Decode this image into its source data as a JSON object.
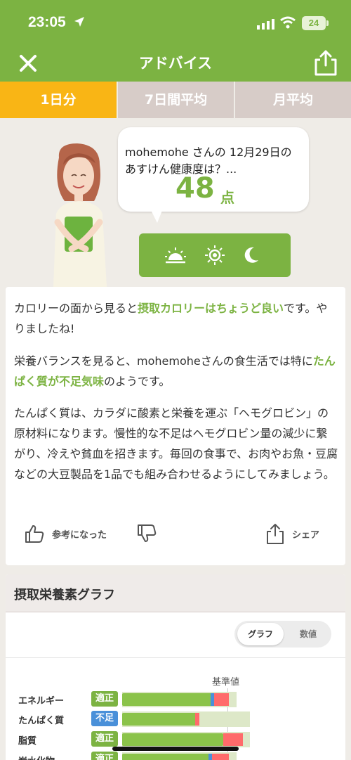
{
  "status": {
    "time": "23:05",
    "battery": "24"
  },
  "nav": {
    "title": "アドバイス"
  },
  "tabs": [
    {
      "label": "1日分",
      "active": true
    },
    {
      "label": "7日間平均",
      "active": false
    },
    {
      "label": "月平均",
      "active": false
    }
  ],
  "hero": {
    "question_line1": "mohemohe さんの 12月29日の",
    "question_line2": "あすけん健康度は？...",
    "score": "48",
    "score_unit": "点",
    "time_icons": [
      "sunrise-icon",
      "sun-icon",
      "moon-icon"
    ]
  },
  "advice": {
    "p1_a": "カロリーの面から見ると",
    "p1_hl": "摂取カロリーはちょうど良い",
    "p1_b": "です。やりましたね!",
    "p2_a": "栄養バランスを見ると、mohemoheさんの食生活では特に",
    "p2_hl": "たんぱく質が不足気味",
    "p2_b": "のようです。",
    "p3": "たんぱく質は、カラダに酸素と栄養を運ぶ「ヘモグロビン」の原材料になります。慢性的な不足はヘモグロビン量の減少に繋がり、冷えや貧血を招きます。毎回の食事で、お肉やお魚・豆腐などの大豆製品を1品でも組み合わせるようにしてみましょう。",
    "helpful_label": "参考になった",
    "share_label": "シェア"
  },
  "graph": {
    "title": "摂取栄養素グラフ",
    "toggle_graph": "グラフ",
    "toggle_values": "数値",
    "reference_label": "基準値",
    "colors": {
      "ok": "#7cb342",
      "short": "#4a90d9",
      "over": "#ff6b6b"
    },
    "rows": [
      {
        "name": "エネルギー",
        "status": "適正",
        "status_type": "ok",
        "level": 0.98
      },
      {
        "name": "たんぱく質",
        "status": "不足",
        "status_type": "short",
        "level": 0.68
      },
      {
        "name": "脂質",
        "status": "適正",
        "status_type": "ok",
        "level": 1.13
      },
      {
        "name": "炭水化物",
        "status": "適正",
        "status_type": "ok",
        "level": 1.0
      }
    ]
  }
}
